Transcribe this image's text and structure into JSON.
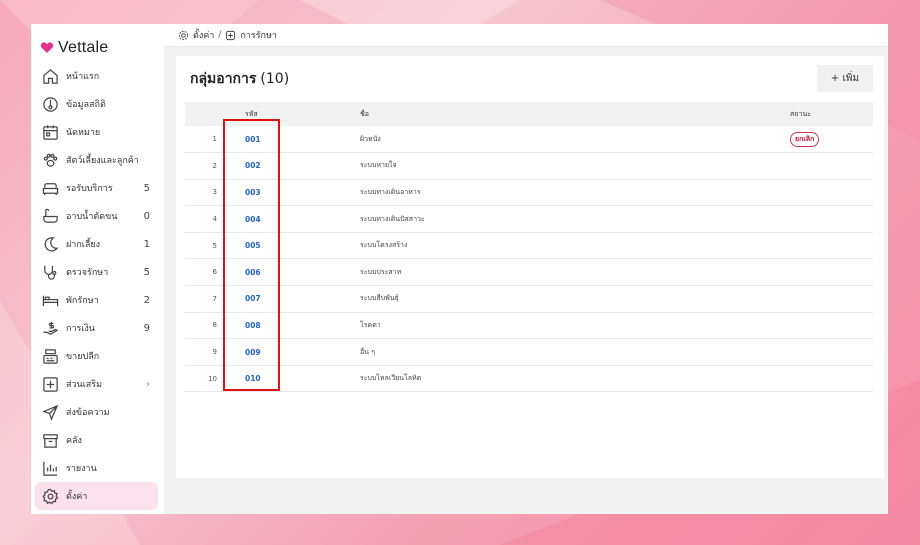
{
  "app": {
    "brand": "Vettale",
    "accent": "#e5318a"
  },
  "sidebar": {
    "items": [
      {
        "label": "หน้าแรก",
        "count": "",
        "icon": "home-icon"
      },
      {
        "label": "ข้อมูลสถิติ",
        "count": "",
        "icon": "thermometer-icon"
      },
      {
        "label": "นัดหมาย",
        "count": "",
        "icon": "calendar-icon"
      },
      {
        "label": "สัตว์เลี้ยงและลูกค้า",
        "count": "",
        "icon": "paw-icon"
      },
      {
        "label": "รอรับบริการ",
        "count": "5",
        "icon": "sofa-icon"
      },
      {
        "label": "อาบน้ำตัดขน",
        "count": "0",
        "icon": "bath-icon"
      },
      {
        "label": "ฝากเลี้ยง",
        "count": "1",
        "icon": "moon-icon"
      },
      {
        "label": "ตรวจรักษา",
        "count": "5",
        "icon": "stethoscope-icon"
      },
      {
        "label": "พักรักษา",
        "count": "2",
        "icon": "bed-icon"
      },
      {
        "label": "การเงิน",
        "count": "9",
        "icon": "money-hand-icon"
      },
      {
        "label": "ขายปลีก",
        "count": "",
        "icon": "cash-register-icon"
      },
      {
        "label": "ส่วนเสริม",
        "count": "›",
        "icon": "plus-square-icon"
      },
      {
        "label": "ส่งข้อความ",
        "count": "",
        "icon": "send-icon"
      },
      {
        "label": "คลัง",
        "count": "",
        "icon": "archive-icon"
      },
      {
        "label": "รายงาน",
        "count": "",
        "icon": "bar-chart-icon"
      },
      {
        "label": "ตั้งค่า",
        "count": "",
        "icon": "gear-icon"
      }
    ]
  },
  "breadcrumb": {
    "settings": "ตั้งค่า",
    "separator": "/",
    "current": "การรักษา"
  },
  "panel": {
    "title": "กลุ่มอาการ",
    "count": "(10)",
    "add_label": "+ เพิ่ม"
  },
  "table": {
    "headers": {
      "code": "รหัส",
      "name": "ชื่อ",
      "status": "สถานะ"
    },
    "rows": [
      {
        "num": "1",
        "code": "001",
        "name": "ผิวหนัง",
        "status": "ยกเลิก"
      },
      {
        "num": "2",
        "code": "002",
        "name": "ระบบหายใจ",
        "status": ""
      },
      {
        "num": "3",
        "code": "003",
        "name": "ระบบทางเดินอาหาร",
        "status": ""
      },
      {
        "num": "4",
        "code": "004",
        "name": "ระบบทางเดินปัสสาวะ",
        "status": ""
      },
      {
        "num": "5",
        "code": "005",
        "name": "ระบบโครงสร้าง",
        "status": ""
      },
      {
        "num": "6",
        "code": "006",
        "name": "ระบบประสาท",
        "status": ""
      },
      {
        "num": "7",
        "code": "007",
        "name": "ระบบสืบพันธุ์",
        "status": ""
      },
      {
        "num": "8",
        "code": "008",
        "name": "โรคตา",
        "status": ""
      },
      {
        "num": "9",
        "code": "009",
        "name": "อื่น ๆ",
        "status": ""
      },
      {
        "num": "10",
        "code": "010",
        "name": "ระบบไหลเวียนโลหิต",
        "status": ""
      }
    ]
  }
}
